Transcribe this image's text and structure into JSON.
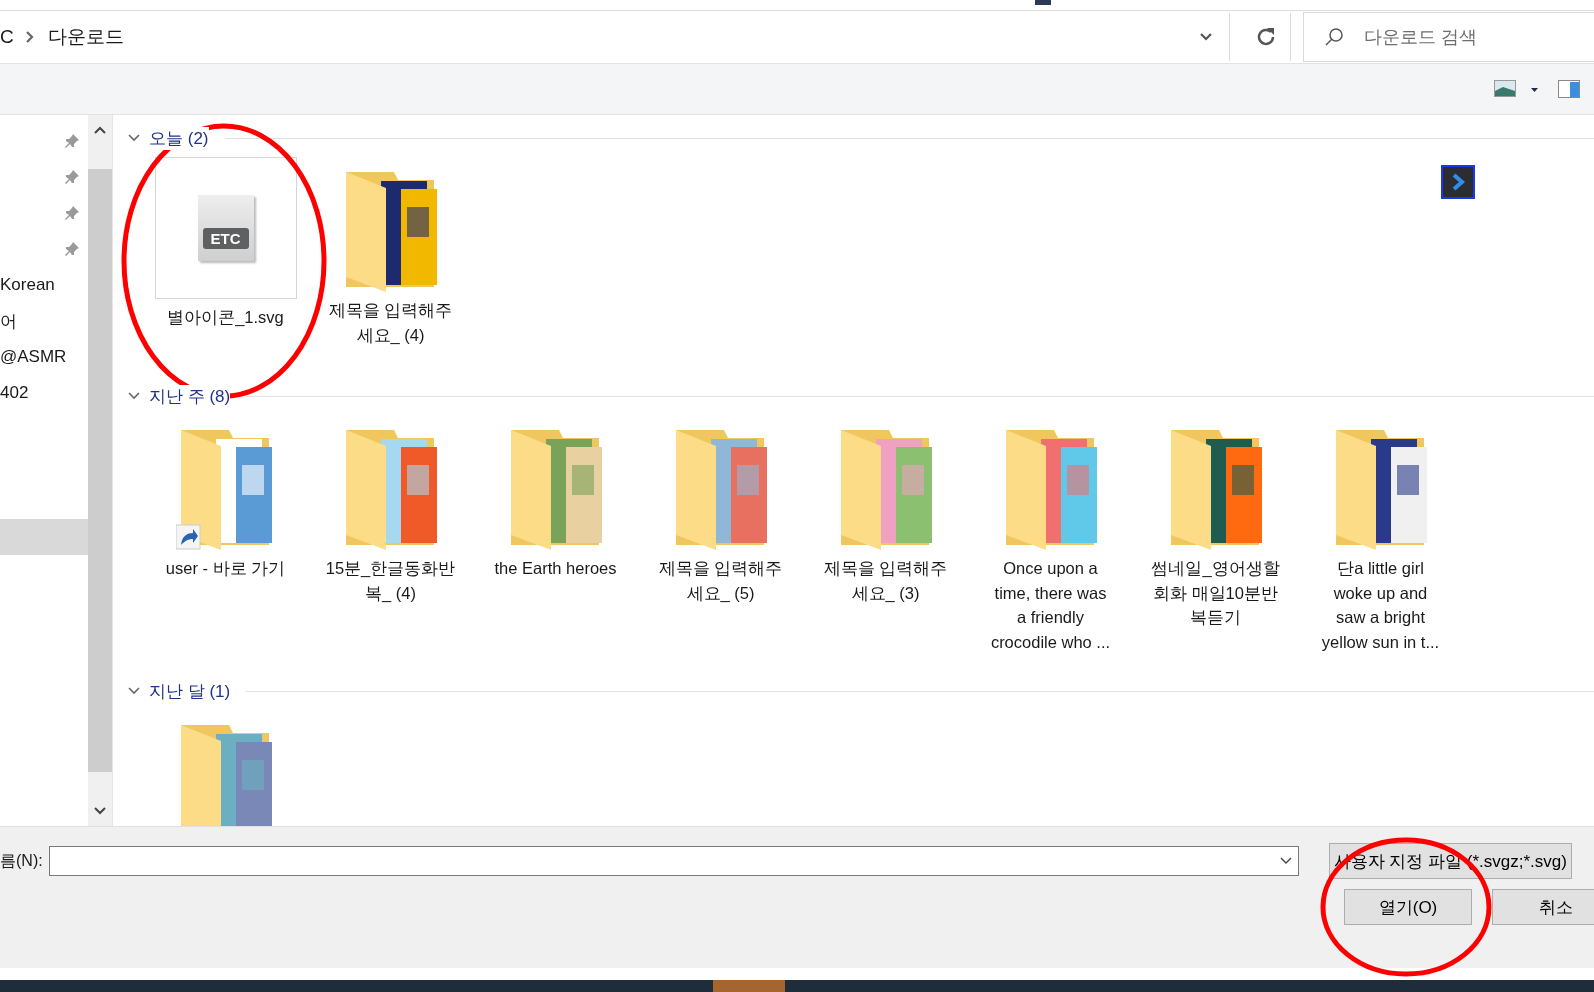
{
  "address_bar": {
    "path": [
      {
        "label": "C"
      },
      {
        "label": "다운로드"
      }
    ],
    "search": {
      "placeholder": "다운로드 검색"
    }
  },
  "sidebar": {
    "items": [
      {
        "pinned": true,
        "selected": false
      },
      {
        "pinned": true,
        "selected": false
      },
      {
        "pinned": true,
        "selected": false
      },
      {
        "pinned": true,
        "selected": false
      },
      {
        "label": "Korean",
        "pinned": false,
        "selected": false
      },
      {
        "label": "어",
        "pinned": false,
        "selected": false
      },
      {
        "label": "@ASMR",
        "pinned": false,
        "selected": false
      },
      {
        "label": "402",
        "pinned": false,
        "selected": false
      },
      {
        "pinned": false,
        "selected": false
      },
      {
        "pinned": false,
        "selected": false
      },
      {
        "pinned": false,
        "selected": false
      },
      {
        "pinned": false,
        "selected": true
      }
    ]
  },
  "groups": [
    {
      "title": "오늘 (2)",
      "expanded": true,
      "items": [
        {
          "kind": "file",
          "type_label": "ETC",
          "lines": [
            "별아이콘_1.svg"
          ],
          "circled": true
        },
        {
          "kind": "folder",
          "lines": [
            "제목을 입력해주",
            "세요_ (4)"
          ],
          "shortcut": false,
          "circled": false
        }
      ]
    },
    {
      "title": "지난 주 (8)",
      "expanded": true,
      "items": [
        {
          "kind": "folder",
          "lines": [
            "user - 바로 가기"
          ],
          "shortcut": true,
          "circled": false
        },
        {
          "kind": "folder",
          "lines": [
            "15분_한글동화반",
            "복_ (4)"
          ],
          "shortcut": false,
          "circled": false
        },
        {
          "kind": "folder",
          "lines": [
            "the Earth heroes"
          ],
          "shortcut": false,
          "circled": false
        },
        {
          "kind": "folder",
          "lines": [
            "제목을 입력해주",
            "세요_ (5)"
          ],
          "shortcut": false,
          "circled": false
        },
        {
          "kind": "folder",
          "lines": [
            "제목을 입력해주",
            "세요_ (3)"
          ],
          "shortcut": false,
          "circled": false
        },
        {
          "kind": "folder",
          "lines": [
            "Once upon a",
            "time, there was",
            "a friendly",
            "crocodile who ..."
          ],
          "shortcut": false,
          "circled": false
        },
        {
          "kind": "folder",
          "lines": [
            "썸네일_영어생할",
            "회화 매일10분반",
            "복듣기"
          ],
          "shortcut": false,
          "circled": false
        },
        {
          "kind": "folder",
          "lines": [
            "단a little girl",
            "woke up and",
            "saw a bright",
            "yellow sun in t..."
          ],
          "shortcut": false,
          "circled": false
        }
      ]
    },
    {
      "title": "지난 달 (1)",
      "expanded": true,
      "items": [
        {
          "kind": "folder",
          "shortcut": false,
          "circled": false
        }
      ]
    }
  ],
  "footer": {
    "filename_label": "름(N):",
    "filter": "사용자 지정 파일 (*.svgz;*.svg)",
    "buttons": [
      {
        "label": "열기(O)",
        "circled": true
      },
      {
        "label": "취소",
        "circled": false
      }
    ]
  }
}
